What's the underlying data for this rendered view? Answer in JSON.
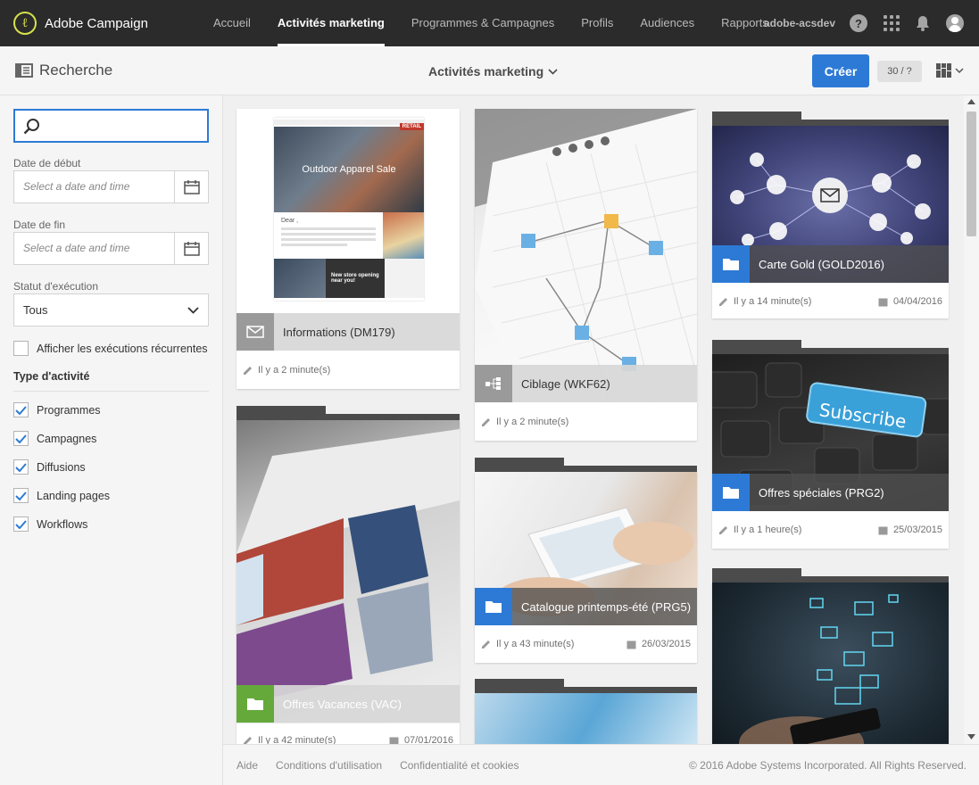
{
  "app": {
    "name": "Adobe Campaign"
  },
  "nav": {
    "items": [
      "Accueil",
      "Activités marketing",
      "Programmes & Campagnes",
      "Profils",
      "Audiences",
      "Rapports"
    ],
    "active_index": 1,
    "username": "adobe-acsdev",
    "help_glyph": "?"
  },
  "subheader": {
    "title": "Recherche",
    "center_title": "Activités marketing",
    "create_label": "Créer",
    "count": "30 / ?"
  },
  "filters": {
    "search_value": "",
    "start_label": "Date de début",
    "start_placeholder": "Select a date and time",
    "end_label": "Date de fin",
    "end_placeholder": "Select a date and time",
    "status_label": "Statut d'exécution",
    "status_value": "Tous",
    "recurring_label": "Afficher les exécutions récurrentes",
    "recurring_checked": false,
    "type_title": "Type d'activité",
    "types": [
      {
        "label": "Programmes",
        "checked": true
      },
      {
        "label": "Campagnes",
        "checked": true
      },
      {
        "label": "Diffusions",
        "checked": true
      },
      {
        "label": "Landing pages",
        "checked": true
      },
      {
        "label": "Workflows",
        "checked": true
      }
    ]
  },
  "cards": [
    {
      "title": "Informations (DM179)",
      "modified": "Il y a 2 minute(s)",
      "date": "",
      "kind": "email",
      "icon": "envelope-icon"
    },
    {
      "title": "Ciblage (WKF62)",
      "modified": "Il y a 2 minute(s)",
      "date": "",
      "kind": "workflow",
      "icon": "workflow-icon"
    },
    {
      "title": "Carte Gold (GOLD2016)",
      "modified": "Il y a 14 minute(s)",
      "date": "04/04/2016",
      "kind": "campaign",
      "icon": "folder-icon"
    },
    {
      "title": "Offres Vacances (VAC)",
      "modified": "Il y a 42 minute(s)",
      "date": "07/01/2016",
      "kind": "program",
      "icon": "folder-icon"
    },
    {
      "title": "Catalogue printemps-été (PRG5)",
      "modified": "Il y a 43 minute(s)",
      "date": "26/03/2015",
      "kind": "campaign",
      "icon": "folder-icon"
    },
    {
      "title": "Offres spéciales (PRG2)",
      "modified": "Il y a 1 heure(s)",
      "date": "25/03/2015",
      "kind": "campaign",
      "icon": "folder-icon"
    }
  ],
  "thumb_text": {
    "email_banner": "Outdoor Apparel Sale",
    "email_greeting": "Dear ,",
    "email_store": "New store opening near you!",
    "email_brand": "RETAIL",
    "subscribe_key": "Subscribe"
  },
  "footer": {
    "links": [
      "Aide",
      "Conditions d'utilisation",
      "Confidentialité et cookies"
    ],
    "copyright": "© 2016 Adobe Systems Incorporated. All Rights Reserved."
  },
  "colors": {
    "accent": "#2d7ad6",
    "topbar": "#2b2b2b",
    "program_green": "#65a93b",
    "campaign_blue": "#2d7ad6",
    "email_gray": "#9a9a9a",
    "logo_yellow": "#d6e14a"
  }
}
